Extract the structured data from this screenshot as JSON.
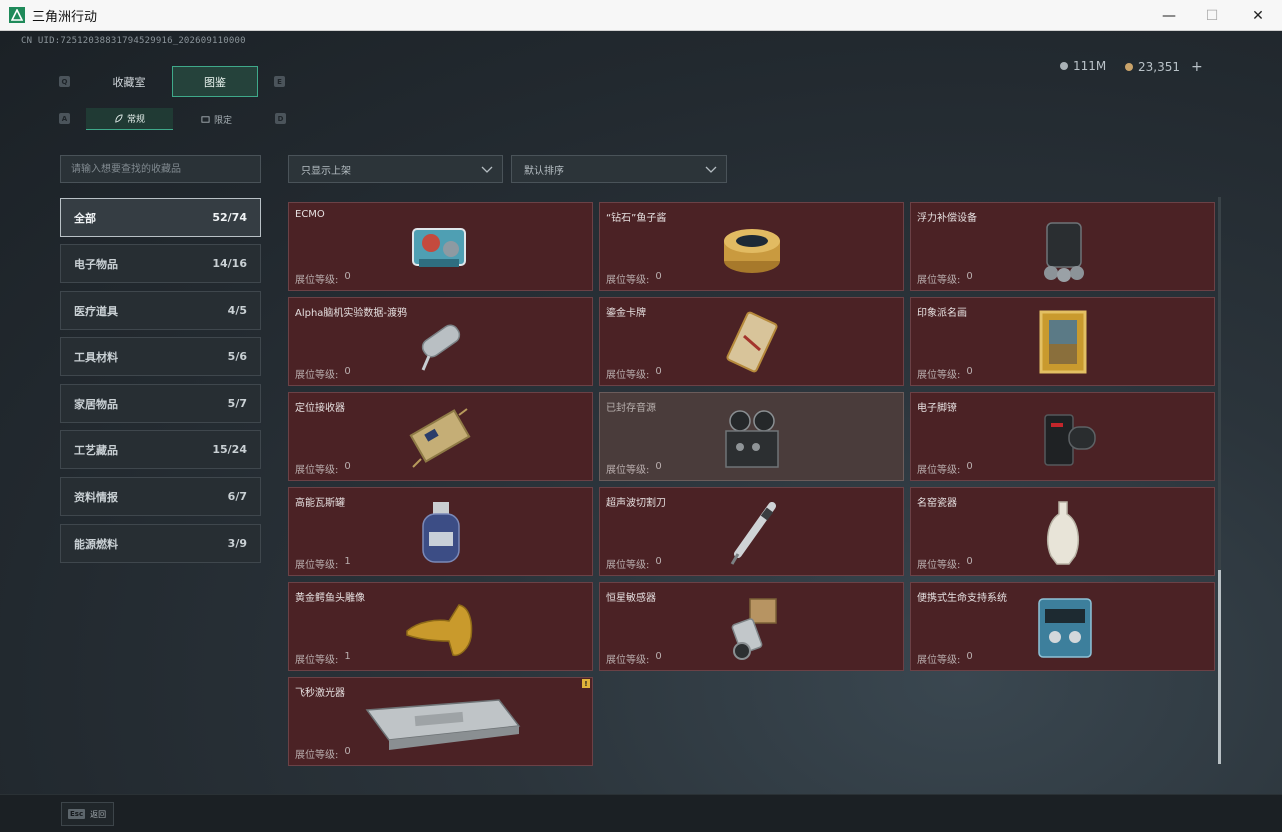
{
  "window": {
    "title": "三角洲行动",
    "minimize": "—",
    "maximize": "☐",
    "close": "✕"
  },
  "header": {
    "uid": "CN UID:72512038831794529916_202609110000",
    "currency": [
      {
        "icon": "silver-coin-icon",
        "value": "111M",
        "color": "#a9b1b6"
      },
      {
        "icon": "gold-coin-icon",
        "value": "23,351",
        "color": "#c9a36a"
      }
    ],
    "add": "+"
  },
  "tabs": {
    "main": [
      "收藏室",
      "图鉴"
    ],
    "main_active": 1,
    "sub": [
      "常规",
      "限定"
    ],
    "sub_active": 0,
    "keys": {
      "q": "Q",
      "e": "E",
      "a": "A",
      "d": "D"
    }
  },
  "search": {
    "placeholder": "请输入想要查找的收藏品"
  },
  "filters": {
    "shelf": "只显示上架",
    "sort": "默认排序"
  },
  "categories": [
    {
      "label": "全部",
      "count": "52/74"
    },
    {
      "label": "电子物品",
      "count": "14/16"
    },
    {
      "label": "医疗道具",
      "count": "4/5"
    },
    {
      "label": "工具材料",
      "count": "5/6"
    },
    {
      "label": "家居物品",
      "count": "5/7"
    },
    {
      "label": "工艺藏品",
      "count": "15/24"
    },
    {
      "label": "资料情报",
      "count": "6/7"
    },
    {
      "label": "能源燃料",
      "count": "3/9"
    }
  ],
  "level_label": "展位等级:",
  "items": [
    {
      "name": "ECMO",
      "level": "0",
      "icon": "ecmo-device-icon"
    },
    {
      "name": "“钻石”鱼子酱",
      "level": "0",
      "icon": "caviar-tin-icon"
    },
    {
      "name": "浮力补偿设备",
      "level": "0",
      "icon": "buoyancy-device-icon"
    },
    {
      "name": "Alpha脑机实验数据-渡鸦",
      "level": "0",
      "icon": "data-cylinder-icon"
    },
    {
      "name": "鎏金卡牌",
      "level": "0",
      "icon": "gilded-card-icon"
    },
    {
      "name": "印象派名画",
      "level": "0",
      "icon": "framed-painting-icon"
    },
    {
      "name": "定位接收器",
      "level": "0",
      "icon": "gps-receiver-icon"
    },
    {
      "name": "已封存音源",
      "level": "0",
      "icon": "reel-recorder-icon",
      "locked": true
    },
    {
      "name": "电子脚镣",
      "level": "0",
      "icon": "ankle-monitor-icon"
    },
    {
      "name": "高能瓦斯罐",
      "level": "1",
      "icon": "gas-canister-icon"
    },
    {
      "name": "超声波切割刀",
      "level": "0",
      "icon": "ultrasonic-knife-icon"
    },
    {
      "name": "名窑瓷器",
      "level": "0",
      "icon": "porcelain-vase-icon"
    },
    {
      "name": "黄金鳄鱼头雕像",
      "level": "1",
      "icon": "gold-crocodile-icon"
    },
    {
      "name": "恒星敏感器",
      "level": "0",
      "icon": "star-sensor-icon"
    },
    {
      "name": "便携式生命支持系统",
      "level": "0",
      "icon": "life-support-icon"
    },
    {
      "name": "飞秒激光器",
      "level": "0",
      "icon": "laser-device-icon",
      "new": true,
      "new_label": "!"
    }
  ],
  "footer": {
    "esc_key": "Esc",
    "back": "返回"
  }
}
